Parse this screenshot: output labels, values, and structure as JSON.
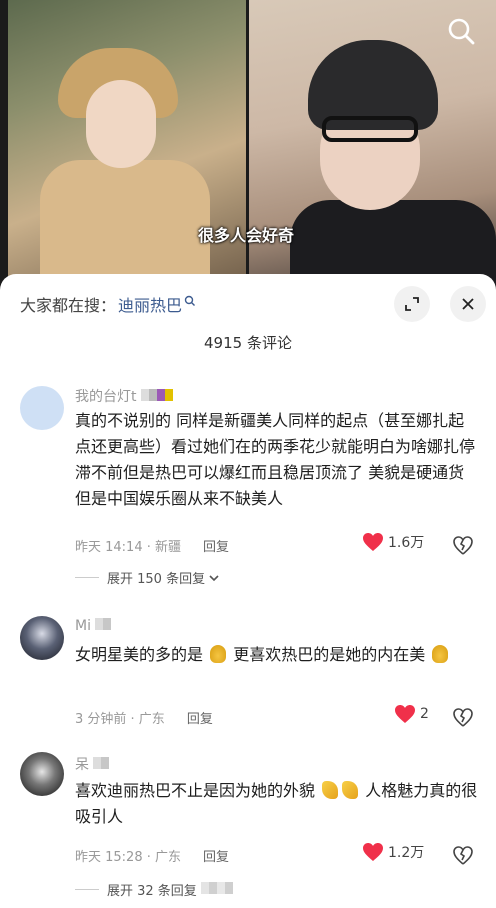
{
  "video": {
    "subtitle": "很多人会好奇"
  },
  "sheet": {
    "search_prefix": "大家都在搜：",
    "search_keyword": "迪丽热巴",
    "comment_count": "4915 条评论"
  },
  "comments": [
    {
      "author": "我的台灯t",
      "text": "真的不说别的 同样是新疆美人同样的起点（甚至娜扎起点还更高些）看过她们在的两季花少就能明白为啥娜扎停滞不前但是热巴可以爆红而且稳居顶流了 美貌是硬通货 但是中国娱乐圈从来不缺美人",
      "meta": "昨天 14:14 · 新疆",
      "reply": "回复",
      "likes": "1.6万",
      "expand": "展开 150 条回复"
    },
    {
      "author": "Mi",
      "text_a": "女明星美的多的是",
      "text_b": "更喜欢热巴的是她的内在美",
      "meta": "3 分钟前 · 广东",
      "reply": "回复",
      "likes": "2"
    },
    {
      "author": "呆",
      "text_a": "喜欢迪丽热巴不止是因为她的外貌",
      "text_b": "人格魅力真的很吸引人",
      "meta": "昨天 15:28 · 广东",
      "reply": "回复",
      "likes": "1.2万",
      "expand": "展开 32 条回复"
    }
  ],
  "colors": {
    "like_red": "#f0304a",
    "keyword_blue": "#3c5b8f"
  }
}
